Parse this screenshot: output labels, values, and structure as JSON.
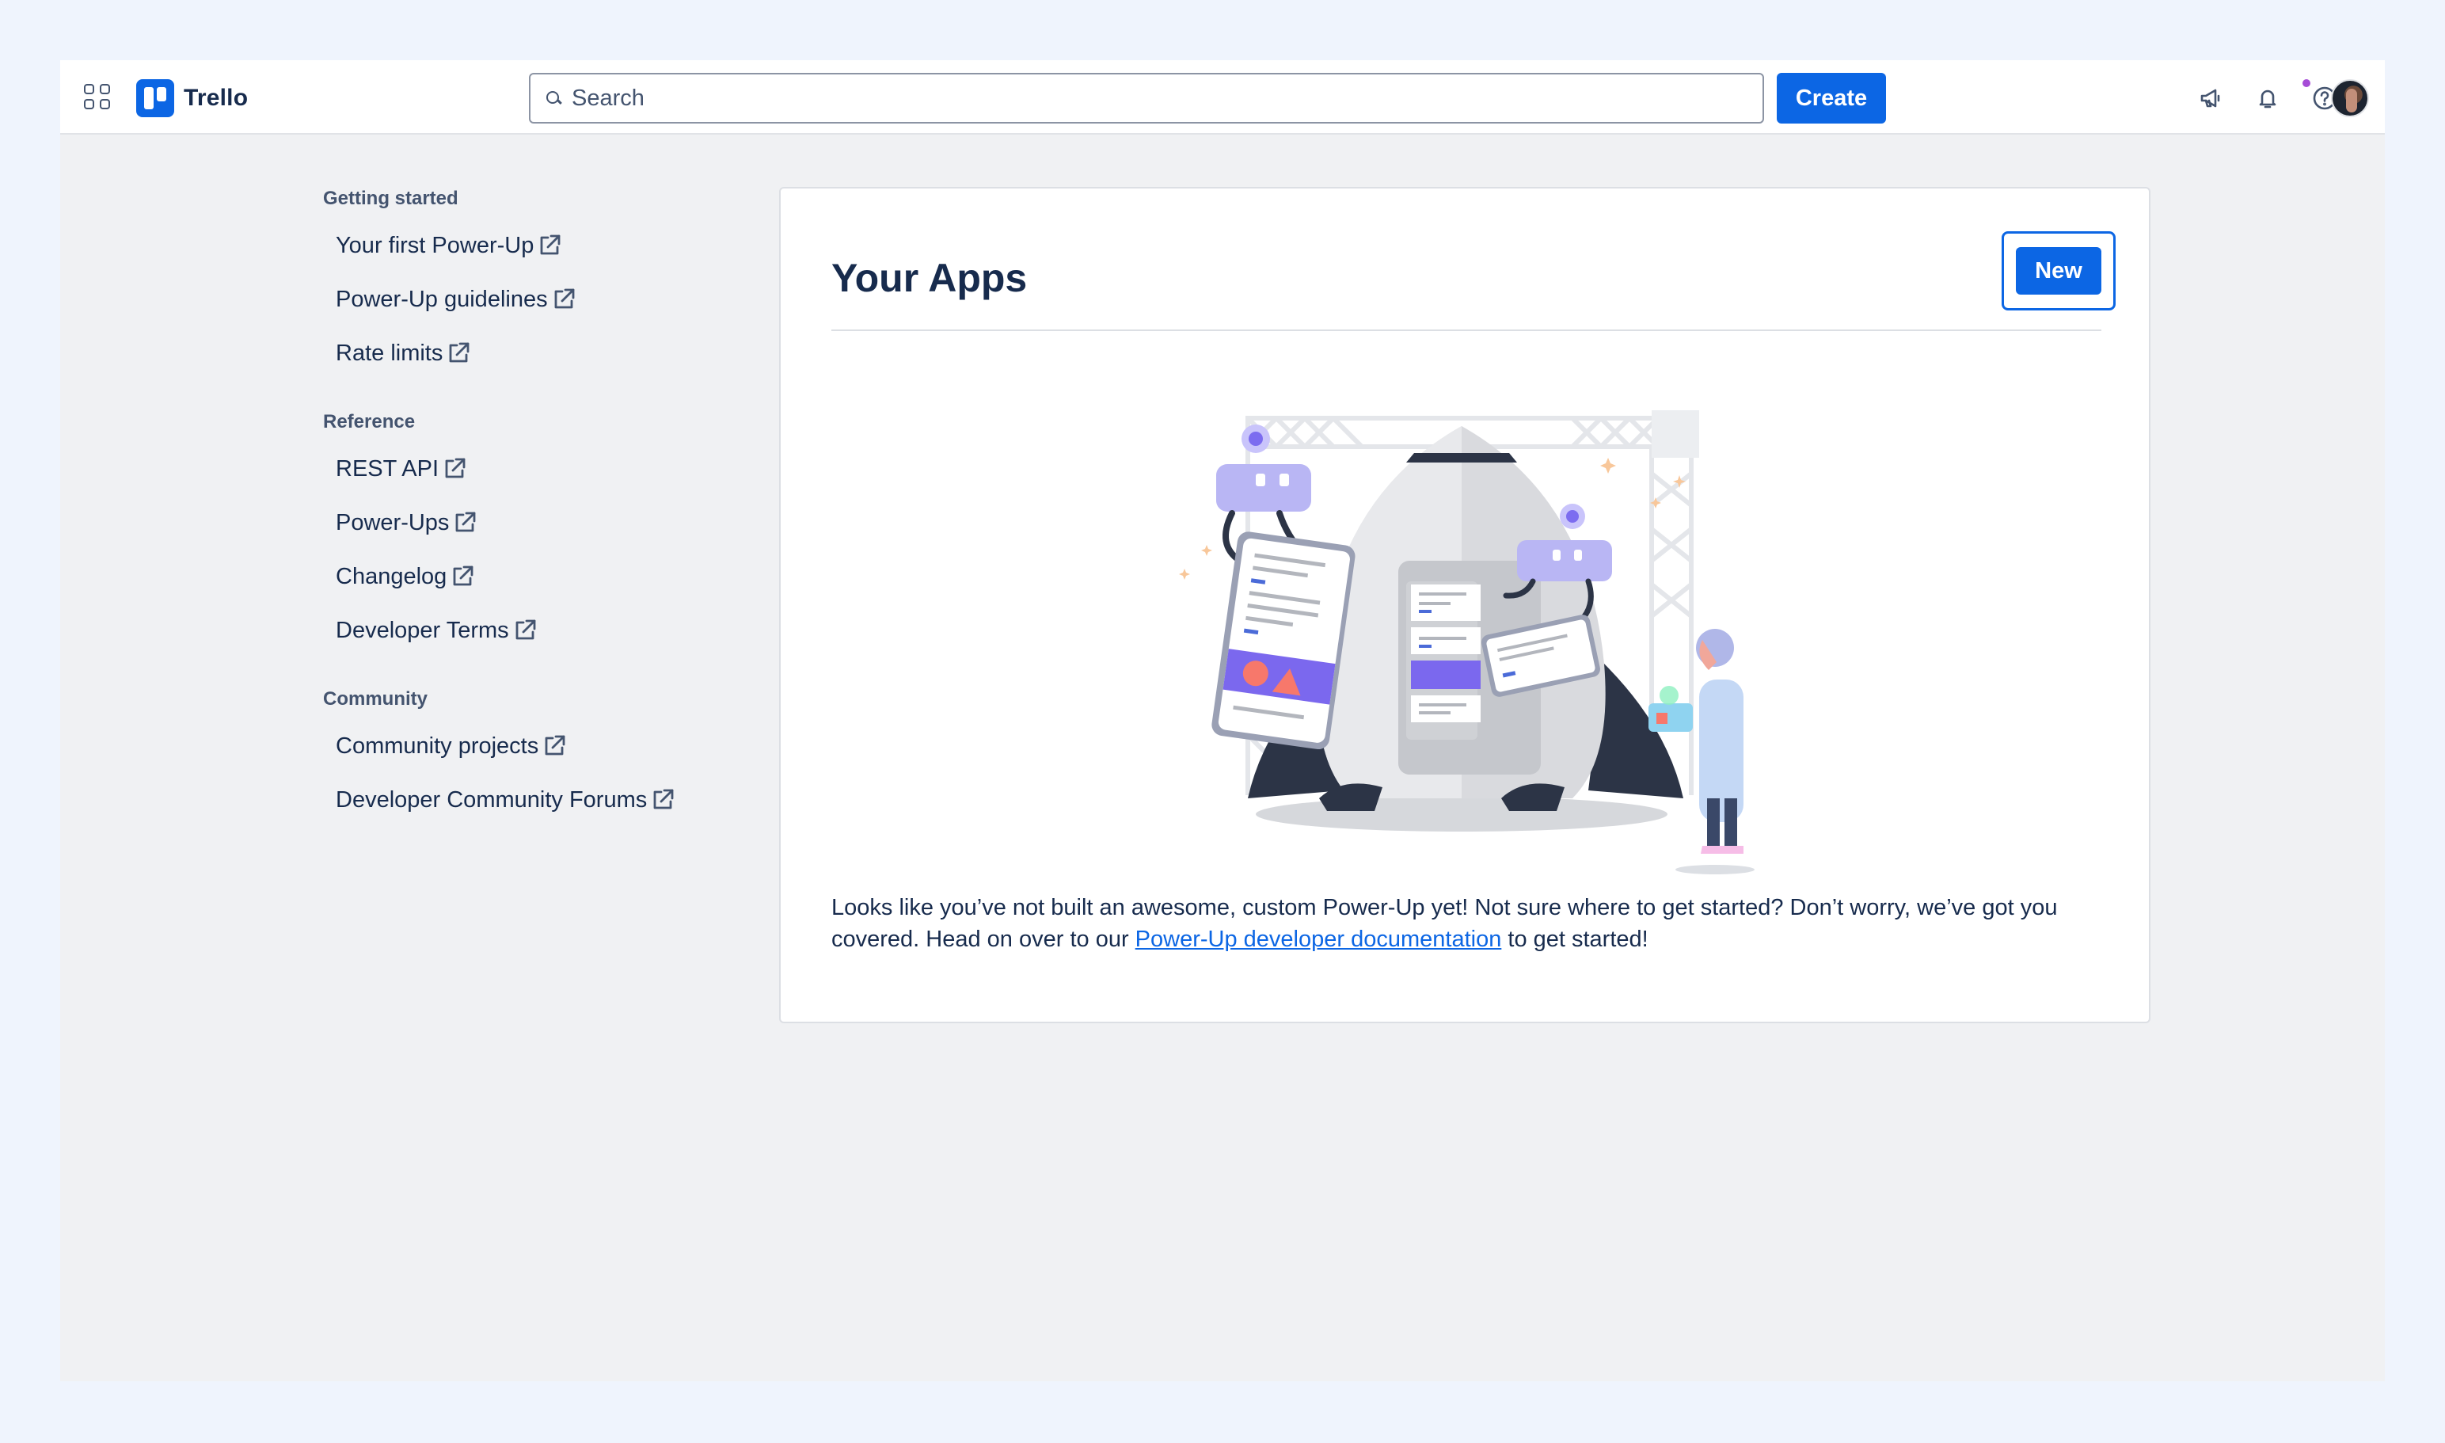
{
  "header": {
    "brand": "Trello",
    "search_placeholder": "Search",
    "create_label": "Create"
  },
  "sidebar": {
    "sections": [
      {
        "title": "Getting started",
        "links": [
          "Your first Power-Up",
          "Power-Up guidelines",
          "Rate limits"
        ]
      },
      {
        "title": "Reference",
        "links": [
          "REST API",
          "Power-Ups",
          "Changelog",
          "Developer Terms"
        ]
      },
      {
        "title": "Community",
        "links": [
          "Community projects",
          "Developer Community Forums"
        ]
      }
    ]
  },
  "main": {
    "title": "Your Apps",
    "new_label": "New",
    "empty_text_before": "Looks like you’ve not built an awesome, custom Power-Up yet! Not sure where to get started? Don’t worry, we’ve got you covered. Head on over to our ",
    "empty_link": "Power-Up developer documentation",
    "empty_text_after": " to get started!"
  },
  "colors": {
    "brand_blue": "#0c66e4",
    "notification_dot": "#a54cd6",
    "page_background": "#eff4fd"
  },
  "icons": [
    "apps-grid-icon",
    "trello-logo-icon",
    "search-icon",
    "megaphone-icon",
    "bell-icon",
    "help-icon",
    "external-link-icon"
  ]
}
